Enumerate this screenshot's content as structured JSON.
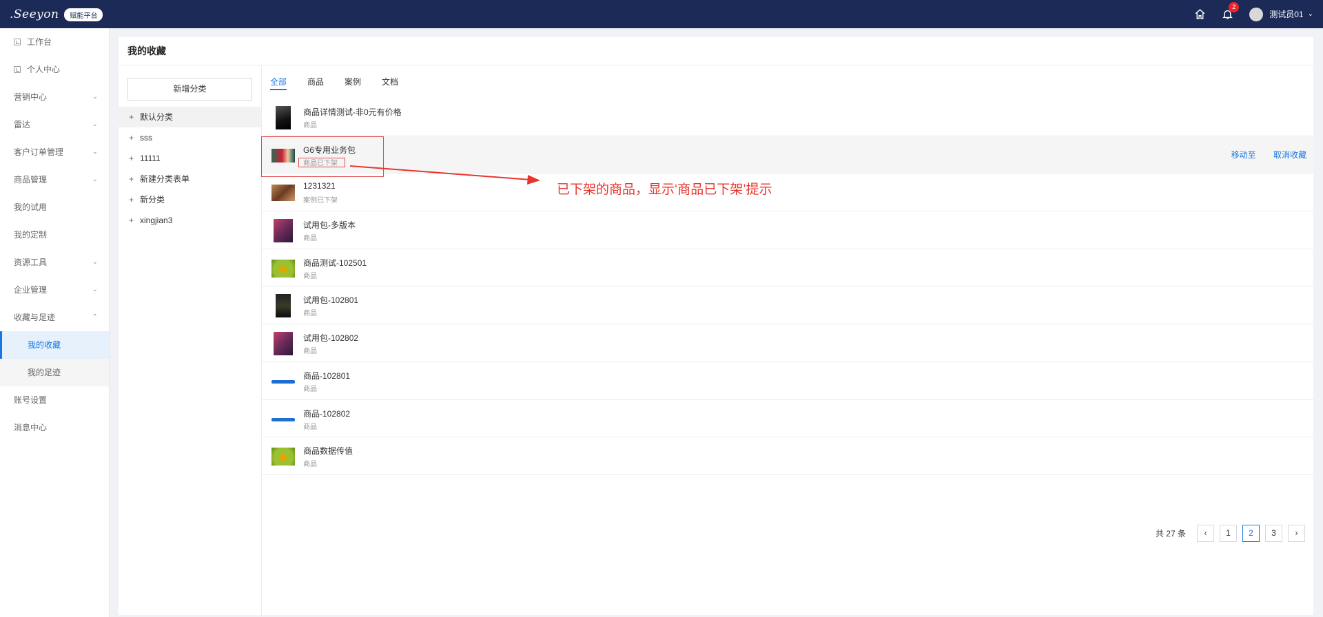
{
  "topbar": {
    "logo_text": ".Seeyon",
    "logo_badge": "赋能平台",
    "notification_count": "2",
    "user_name": "测试员01"
  },
  "sidebar": {
    "items": [
      {
        "label": "工作台"
      },
      {
        "label": "个人中心"
      },
      {
        "label": "营销中心"
      },
      {
        "label": "雷达"
      },
      {
        "label": "客户订单管理"
      },
      {
        "label": "商品管理"
      },
      {
        "label": "我的试用"
      },
      {
        "label": "我的定制"
      },
      {
        "label": "资源工具"
      },
      {
        "label": "企业管理"
      },
      {
        "label": "收藏与足迹"
      },
      {
        "label": "我的收藏"
      },
      {
        "label": "我的足迹"
      },
      {
        "label": "账号设置"
      },
      {
        "label": "消息中心"
      }
    ]
  },
  "page": {
    "title": "我的收藏"
  },
  "categories": {
    "add_button": "新增分类",
    "items": [
      "默认分类",
      "sss",
      "11111",
      "新建分类表单",
      "新分类",
      "xingjian3"
    ]
  },
  "tabs": [
    "全部",
    "商品",
    "案例",
    "文档"
  ],
  "list": [
    {
      "title": "商品详情测试-非0元有价格",
      "subtitle": "商品"
    },
    {
      "title": "G6专用业务包",
      "subtitle": "商品已下架"
    },
    {
      "title": "1231321",
      "subtitle": "案例已下架"
    },
    {
      "title": "试用包-多版本",
      "subtitle": "商品"
    },
    {
      "title": "商品测试-102501",
      "subtitle": "商品"
    },
    {
      "title": "试用包-102801",
      "subtitle": "商品"
    },
    {
      "title": "试用包-102802",
      "subtitle": "商品"
    },
    {
      "title": "商品-102801",
      "subtitle": "商品"
    },
    {
      "title": "商品-102802",
      "subtitle": "商品"
    },
    {
      "title": "商品数据传值",
      "subtitle": "商品"
    }
  ],
  "row_actions": {
    "move_to": "移动至",
    "cancel_favorite": "取消收藏"
  },
  "pagination": {
    "total": "共 27 条",
    "pages": [
      "1",
      "2",
      "3"
    ],
    "current": "2"
  },
  "annotation": {
    "text": "已下架的商品，显示‘商品已下架’提示",
    "color": "#e8352b"
  }
}
